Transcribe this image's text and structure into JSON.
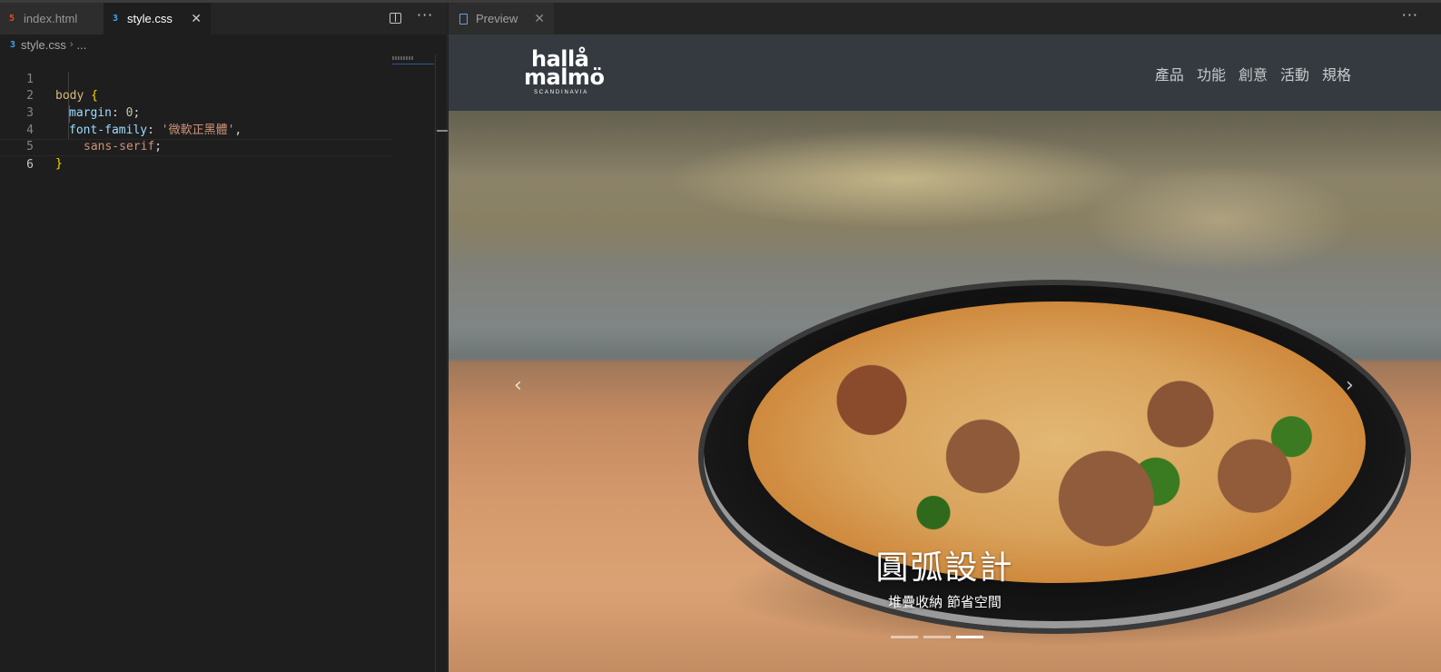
{
  "editor": {
    "tabs": [
      {
        "label": "index.html",
        "icon": "html5-icon",
        "active": false
      },
      {
        "label": "style.css",
        "icon": "css3-icon",
        "active": true
      }
    ],
    "breadcrumb": {
      "file": "style.css",
      "rest": "..."
    },
    "code_lines": [
      {
        "num": "1",
        "selector": "body",
        "open": " {"
      },
      {
        "num": "2",
        "prop": "margin",
        "colon": ": ",
        "value": "0",
        "end": ";"
      },
      {
        "num": "3",
        "prop": "font-family",
        "colon": ": ",
        "value": "'微軟正黑體'",
        "end": ","
      },
      {
        "num": "4",
        "value": "sans-serif",
        "end": ";"
      },
      {
        "num": "5",
        "close": "}"
      },
      {
        "num": "6"
      }
    ]
  },
  "preview": {
    "tab_label": "Preview",
    "site": {
      "logo": {
        "line1": "hallå",
        "line2": "malmö",
        "tagline": "SCANDINAVIA"
      },
      "menu": [
        "產品",
        "功能",
        "創意",
        "活動",
        "規格"
      ],
      "carousel": {
        "title": "圓弧設計",
        "subtitle": "堆疊收納 節省空間",
        "slide_count": 3,
        "active_slide": 3
      }
    }
  },
  "colors": {
    "editor_bg": "#1e1e1e",
    "navbar_bg": "#343a40",
    "css_icon": "#42a5f5",
    "html_icon": "#e44d26"
  }
}
